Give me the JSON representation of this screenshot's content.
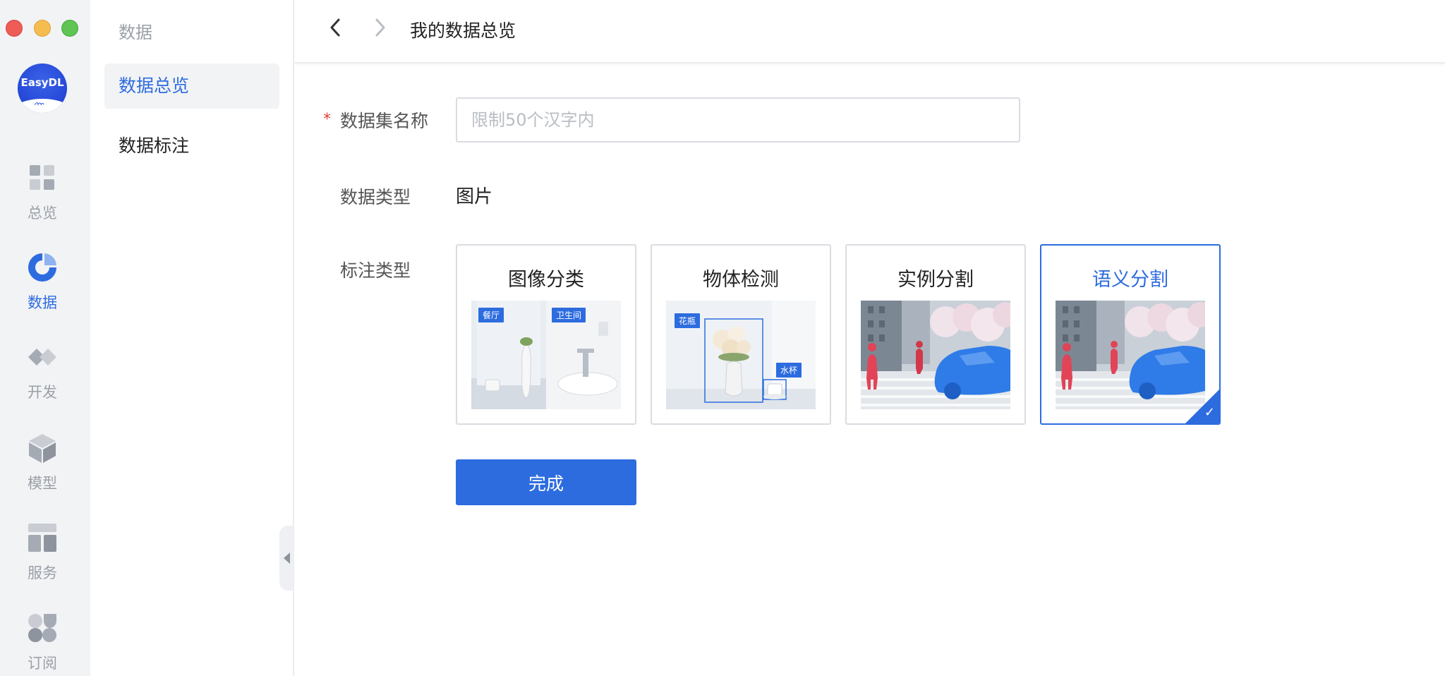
{
  "window": {
    "traffic_lights": [
      "close",
      "minimize",
      "zoom"
    ]
  },
  "logo": {
    "text": "EasyDL",
    "colors": {
      "primary": "#2447d6"
    }
  },
  "rail": {
    "items": [
      {
        "label": "总览",
        "icon": "dashboard-grid-icon",
        "active": false
      },
      {
        "label": "数据",
        "icon": "pie-chart-icon",
        "active": true
      },
      {
        "label": "开发",
        "icon": "diamond-pair-icon",
        "active": false
      },
      {
        "label": "模型",
        "icon": "cube-icon",
        "active": false
      },
      {
        "label": "服务",
        "icon": "layout-panels-icon",
        "active": false
      },
      {
        "label": "订阅",
        "icon": "clover-icon",
        "active": false
      }
    ]
  },
  "subnav": {
    "title": "数据",
    "items": [
      {
        "label": "数据总览",
        "active": true
      },
      {
        "label": "数据标注",
        "active": false
      }
    ]
  },
  "header": {
    "back_icon": "chevron-left-icon",
    "forward_icon": "chevron-right-icon",
    "title": "我的数据总览"
  },
  "form": {
    "dataset_name": {
      "label": "数据集名称",
      "required": true,
      "value": "",
      "placeholder": "限制50个汉字内"
    },
    "data_type": {
      "label": "数据类型",
      "value": "图片"
    },
    "annotation_type": {
      "label": "标注类型",
      "options": [
        {
          "label": "图像分类",
          "tags": [
            "餐厅",
            "卫生间"
          ],
          "selected": false
        },
        {
          "label": "物体检测",
          "tags": [
            "花瓶",
            "水杯"
          ],
          "selected": false
        },
        {
          "label": "实例分割",
          "tags": [],
          "selected": false
        },
        {
          "label": "语义分割",
          "tags": [],
          "selected": true
        }
      ]
    },
    "submit_label": "完成"
  },
  "colors": {
    "accent": "#2d6cdf",
    "required": "#e0413a",
    "muted": "#9aa0a8"
  }
}
